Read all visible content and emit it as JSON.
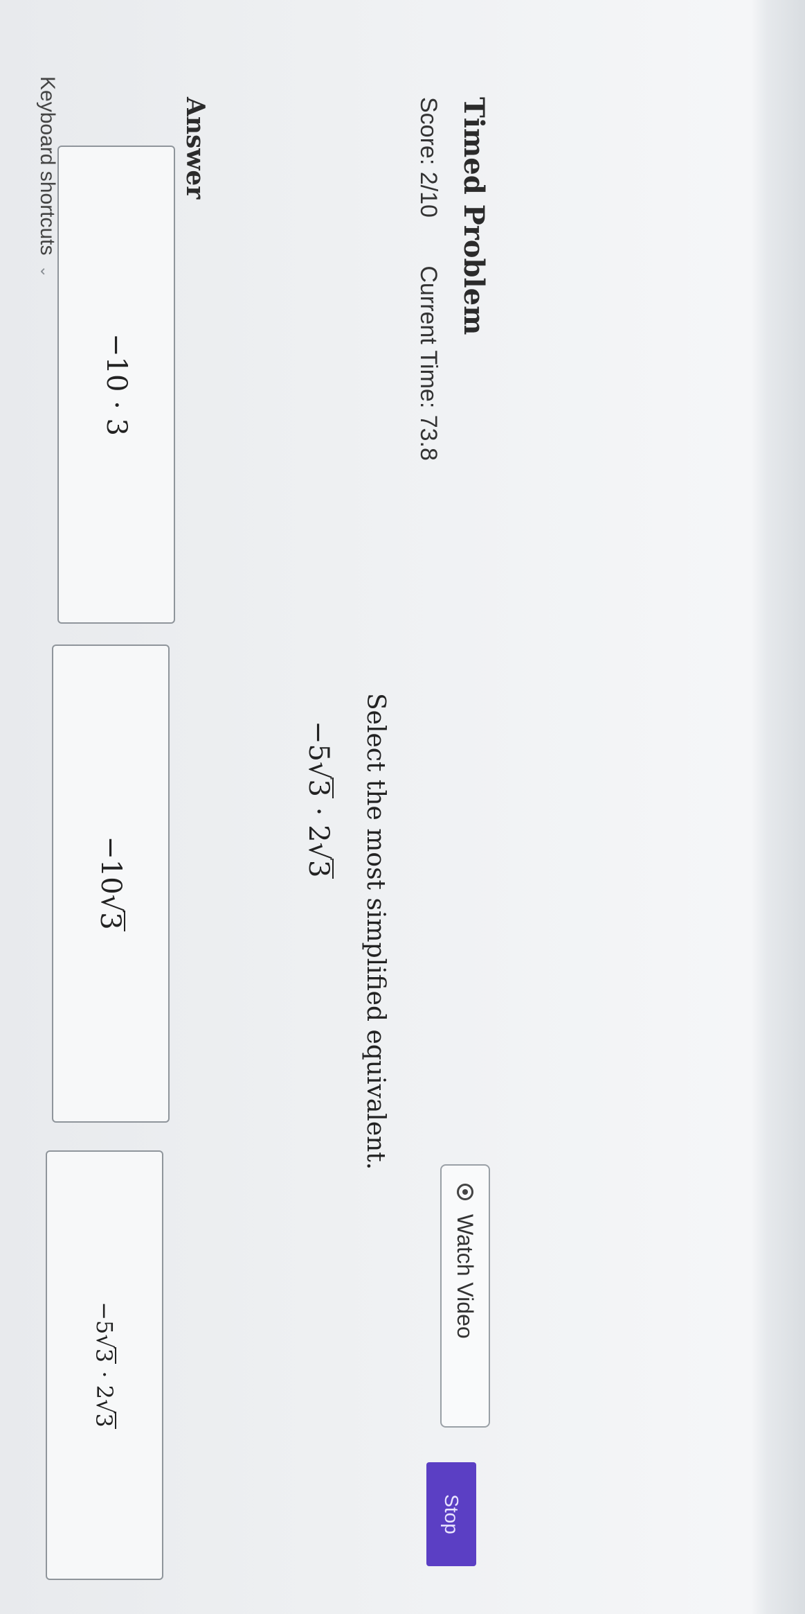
{
  "header": {
    "title": "Timed Problem",
    "score": "Score: 2/10",
    "current_time": "Current Time: 73.8"
  },
  "actions": {
    "watch_video_label": "Watch Video",
    "stop_label": "Stop"
  },
  "question": {
    "prompt": "Select the most simplified equivalent.",
    "expression_coef1": "−5",
    "expression_rad1": "3",
    "expression_op": "·",
    "expression_coef2": "2",
    "expression_rad2": "3"
  },
  "answer": {
    "label": "Answer",
    "choices": [
      {
        "text": "−10 · 3"
      },
      {
        "coef": "−10",
        "rad": "3"
      },
      {
        "coef1": "−5",
        "rad1": "3",
        "op": "·",
        "coef2": "2",
        "rad2": "3"
      }
    ]
  },
  "footer": {
    "keyboard_shortcuts": "Keyboard shortcuts"
  },
  "colors": {
    "stop_button": "#5b3fc4",
    "background": "#f1f2f4"
  }
}
